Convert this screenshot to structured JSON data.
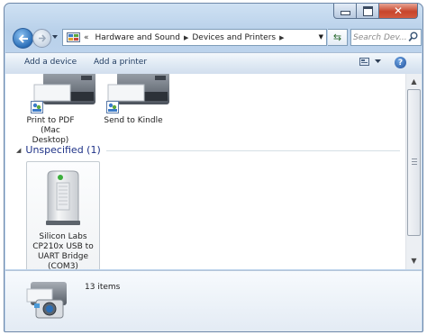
{
  "window": {
    "caption_buttons": [
      "minimize",
      "maximize",
      "close"
    ]
  },
  "navigation": {
    "breadcrumb": [
      "Hardware and Sound",
      "Devices and Printers"
    ],
    "search_placeholder": "Search Dev..."
  },
  "command_bar": {
    "add_device": "Add a device",
    "add_printer": "Add a printer"
  },
  "devices_top": [
    {
      "label_line1": "Print to PDF (Mac",
      "label_line2": "Desktop)",
      "icon": "printer-icon"
    },
    {
      "label_line1": "Send to Kindle",
      "label_line2": "",
      "icon": "printer-icon"
    }
  ],
  "group": {
    "title": "Unspecified (1)"
  },
  "unspecified_device": {
    "lines": [
      "Silicon Labs",
      "CP210x USB to",
      "UART Bridge",
      "(COM3)"
    ],
    "icon": "usb-device-icon"
  },
  "details": {
    "item_count": "13 items",
    "icon": "printer-camera-icon"
  },
  "colors": {
    "group_title": "#1e3287",
    "titlebar": "#bcd3ec",
    "close_button": "#c7452c"
  }
}
